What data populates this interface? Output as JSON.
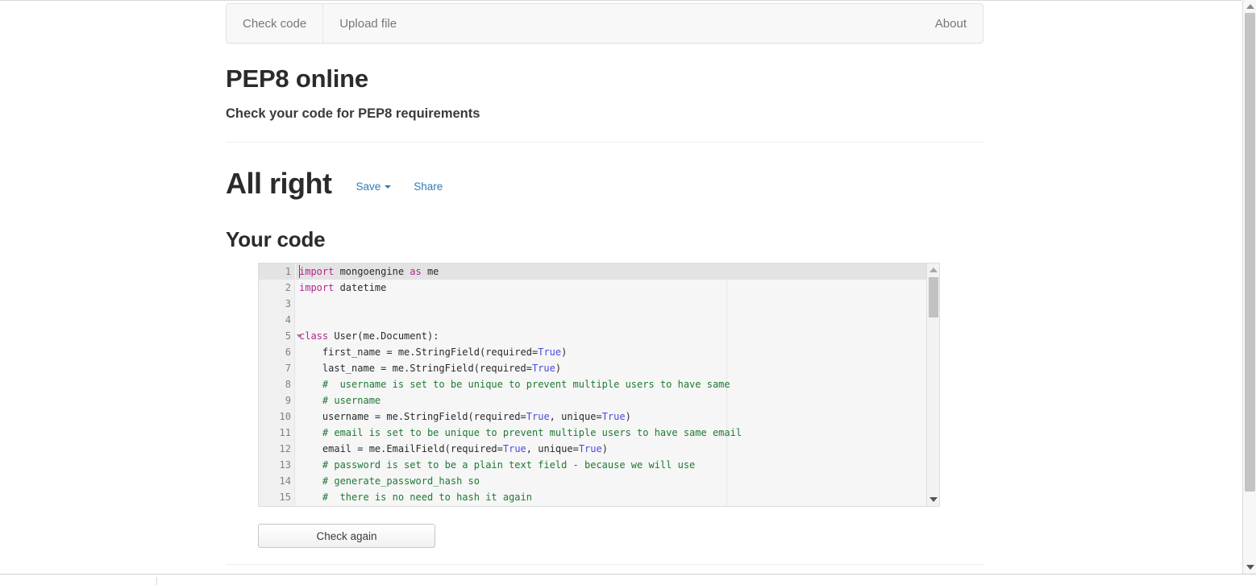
{
  "navbar": {
    "items": [
      {
        "label": "Check code",
        "name": "nav-check-code"
      },
      {
        "label": "Upload file",
        "name": "nav-upload-file"
      }
    ],
    "right_items": [
      {
        "label": "About",
        "name": "nav-about"
      }
    ]
  },
  "header": {
    "title": "PEP8 online",
    "subtitle": "Check your code for PEP8 requirements"
  },
  "result": {
    "title": "All right",
    "save_label": "Save",
    "share_label": "Share"
  },
  "code_section": {
    "title": "Your code",
    "check_again_label": "Check again"
  },
  "editor": {
    "active_line": 1,
    "fold_lines": [
      5
    ],
    "lines": [
      {
        "n": "1",
        "tokens": [
          {
            "t": "import",
            "c": "kw"
          },
          {
            "t": " mongoengine ",
            "c": ""
          },
          {
            "t": "as",
            "c": "kw"
          },
          {
            "t": " me",
            "c": ""
          }
        ]
      },
      {
        "n": "2",
        "tokens": [
          {
            "t": "import",
            "c": "kw"
          },
          {
            "t": " datetime",
            "c": ""
          }
        ]
      },
      {
        "n": "3",
        "tokens": []
      },
      {
        "n": "4",
        "tokens": []
      },
      {
        "n": "5",
        "tokens": [
          {
            "t": "class",
            "c": "kw"
          },
          {
            "t": " User(me.Document):",
            "c": ""
          }
        ]
      },
      {
        "n": "6",
        "tokens": [
          {
            "t": "    first_name = me.StringField(required=",
            "c": ""
          },
          {
            "t": "True",
            "c": "bool"
          },
          {
            "t": ")",
            "c": ""
          }
        ]
      },
      {
        "n": "7",
        "tokens": [
          {
            "t": "    last_name = me.StringField(required=",
            "c": ""
          },
          {
            "t": "True",
            "c": "bool"
          },
          {
            "t": ")",
            "c": ""
          }
        ]
      },
      {
        "n": "8",
        "tokens": [
          {
            "t": "    #  username is set to be unique to prevent multiple users to have same",
            "c": "com"
          }
        ]
      },
      {
        "n": "9",
        "tokens": [
          {
            "t": "    # username",
            "c": "com"
          }
        ]
      },
      {
        "n": "10",
        "tokens": [
          {
            "t": "    username = me.StringField(required=",
            "c": ""
          },
          {
            "t": "True",
            "c": "bool"
          },
          {
            "t": ", unique=",
            "c": ""
          },
          {
            "t": "True",
            "c": "bool"
          },
          {
            "t": ")",
            "c": ""
          }
        ]
      },
      {
        "n": "11",
        "tokens": [
          {
            "t": "    # email is set to be unique to prevent multiple users to have same email",
            "c": "com"
          }
        ]
      },
      {
        "n": "12",
        "tokens": [
          {
            "t": "    email = me.EmailField(required=",
            "c": ""
          },
          {
            "t": "True",
            "c": "bool"
          },
          {
            "t": ", unique=",
            "c": ""
          },
          {
            "t": "True",
            "c": "bool"
          },
          {
            "t": ")",
            "c": ""
          }
        ]
      },
      {
        "n": "13",
        "tokens": [
          {
            "t": "    # password is set to be a plain text field - because we will use",
            "c": "com"
          }
        ]
      },
      {
        "n": "14",
        "tokens": [
          {
            "t": "    # generate_password_hash so",
            "c": "com"
          }
        ]
      },
      {
        "n": "15",
        "tokens": [
          {
            "t": "    #  there is no need to hash it again",
            "c": "com"
          }
        ]
      }
    ]
  },
  "colors": {
    "link": "#337ab7",
    "keyword": "#b4258b",
    "boolean": "#4a4ae0",
    "comment": "#1d7a33",
    "navbar_bg": "#f8f8f8",
    "editor_bg": "#f6f6f6",
    "gutter_bg": "#f0f0f0"
  }
}
